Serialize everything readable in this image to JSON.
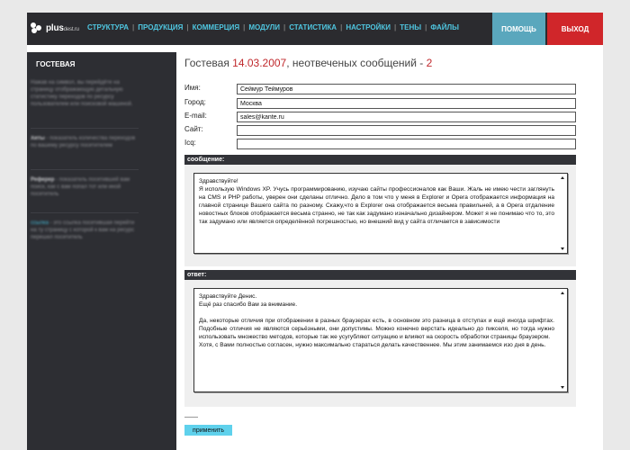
{
  "logo": {
    "brand": "plus",
    "brand_small": "dest.ru"
  },
  "nav": {
    "items": [
      "СТРУКТУРА",
      "ПРОДУКЦИЯ",
      "КОММЕРЦИЯ",
      "МОДУЛИ",
      "СТАТИСТИКА",
      "НАСТРОЙКИ",
      "ТЕНЫ",
      "ФАЙЛЫ"
    ],
    "separator": "|"
  },
  "header_buttons": {
    "help": "ПОМОЩЬ",
    "exit": "ВЫХОД"
  },
  "sidebar": {
    "title": "ГОСТЕВАЯ",
    "blocks": [
      {
        "text": "Нажав на символ, вы перейдёте на страницу отображающую детальную статистику переходов по ресурсу пользователем или поисковой машиной."
      },
      {
        "bold": "Хиты",
        "text": " - показатель количества переходов по вашему ресурсу посетителем"
      },
      {
        "bold": "Реферер",
        "text": " - показатель посетившей вам поиск, как с вам попал тот или иной посетитель"
      },
      {
        "highlight": "ссылка",
        "text": " - это ссылка посетившая перейти на ту страницу с которой к вам на ресурс перешел посетитель"
      }
    ]
  },
  "main": {
    "heading_prefix": "Гостевая",
    "heading_date": "14.03.2007",
    "heading_middle": ", неотвеченых сообщений -",
    "heading_count": "2",
    "fields": [
      {
        "label": "Имя:",
        "value": "Сеймур Теймуров"
      },
      {
        "label": "Город:",
        "value": "Москва"
      },
      {
        "label": "E-mail:",
        "value": "sales@kante.ru"
      },
      {
        "label": "Сайт:",
        "value": ""
      },
      {
        "label": "Icq:",
        "value": ""
      }
    ],
    "message_label": "сообщение:",
    "message_lines": [
      "Здравствуйте!",
      "Я использую Windows XP. Учусь программированию, изучаю сайты профессионалов как Ваши. Жаль не имею чести заглянуть на CMS и PHP работы, уверен они сделаны отлично. Дело в том что у меня в Explorer и Opera отображается информация на главной странице Вашего сайта по разному. Скажу,что в Explorer она отображается весьма правильней, а в Opera отдаление новостных блоков отображается весьма странно, не так как задумано изначально дизайнером. Может я не понимаю что то, это так задумано или является определённой погрешностью, но внешний вид у сайта отличается в зависимости"
    ],
    "answer_label": "ответ:",
    "answer_lines": [
      "Здравствуйте Денис.",
      "Ещё раз спасибо Вам за внимание.",
      "",
      "Да, некоторые отличия при отображении в разных браузерах есть, в основном это разница в отступах и ещё иногда шрифтах. Подобные отличия не являются серьёзными, они допустимы. Можно конечно верстать идеально до пикселя, но тогда нужно использовать множество методов, которые так же усугубляют ситуацию и влияют на скорость обработки страницы браузером.",
      "Хотя, с Вами полностью согласен, нужно максимально стараться делать качественнее. Мы этим занимаемся изо дня в день."
    ],
    "apply_button": "применить"
  }
}
